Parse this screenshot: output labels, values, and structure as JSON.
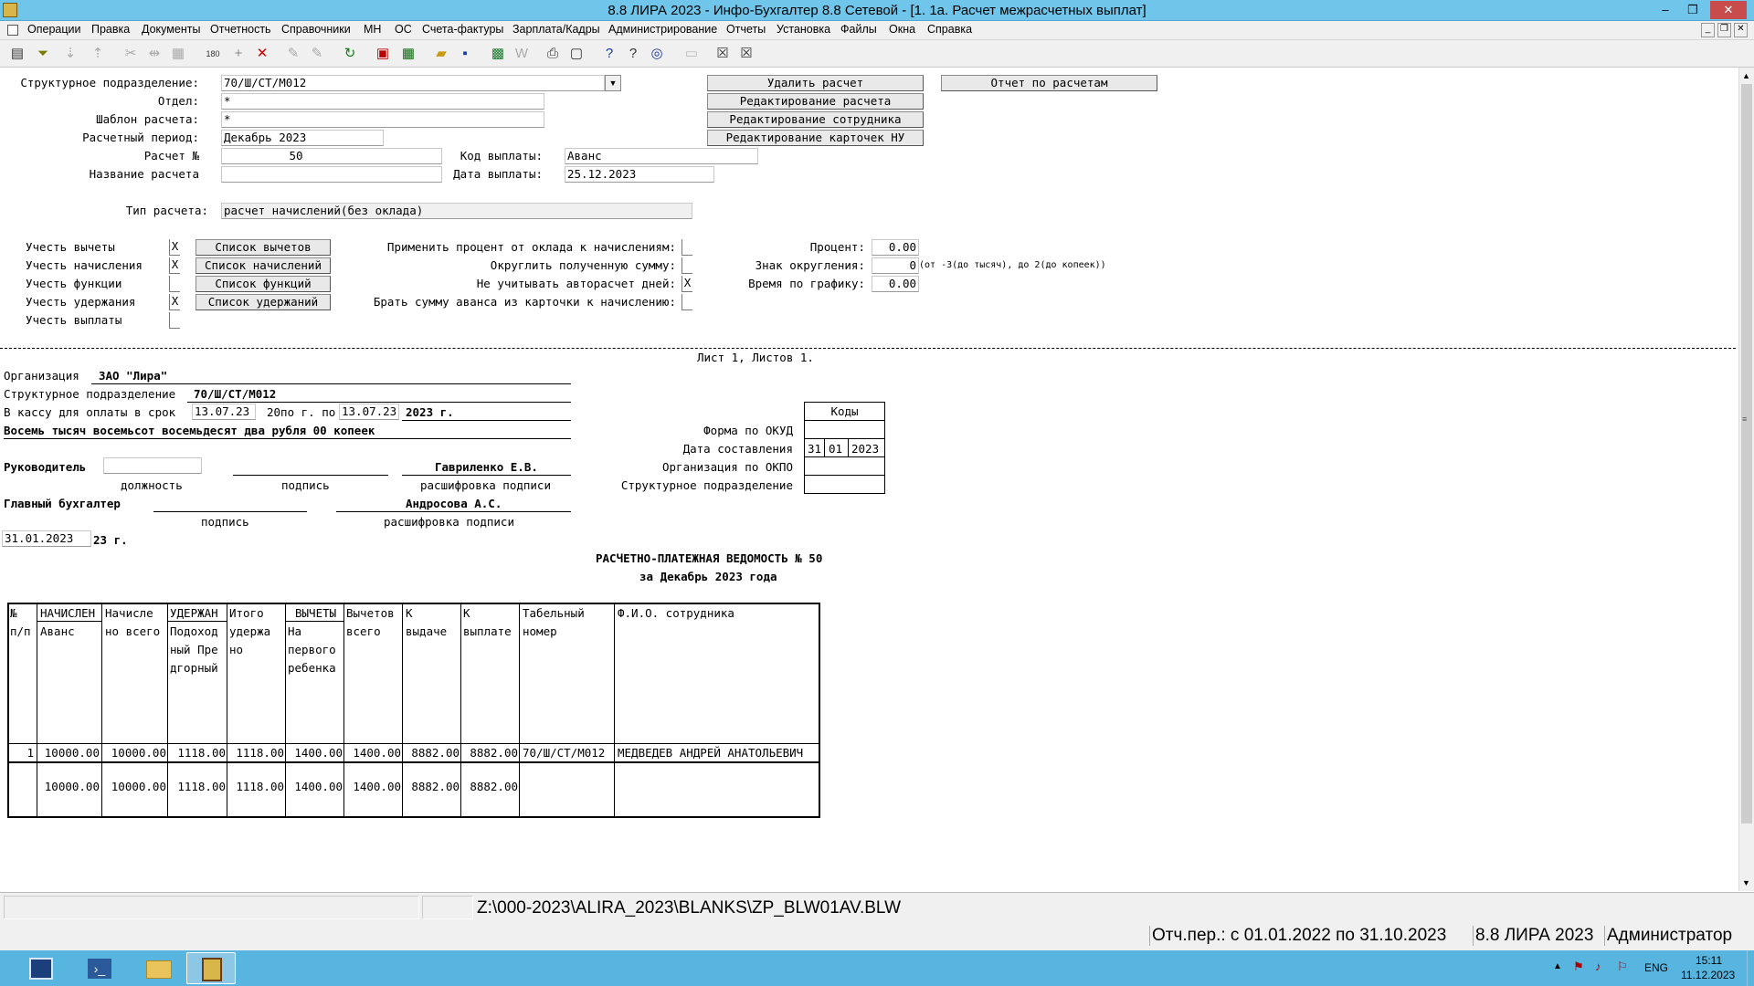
{
  "window": {
    "title": "8.8 ЛИРА 2023 - Инфо-Бухгалтер 8.8 Сетевой - [1. 1а. Расчет межрасчетных выплат]",
    "minimize": "–",
    "restore": "❐",
    "close": "✕"
  },
  "menu": [
    "Операции",
    "Правка",
    "Документы",
    "Отчетность",
    "Справочники",
    "МН",
    "ОС",
    "Счета-фактуры",
    "Зарплата/Кадры",
    "Администрирование",
    "Отчеты",
    "Установка",
    "Файлы",
    "Окна",
    "Справка"
  ],
  "form": {
    "struct_label": "Структурное подразделение:",
    "struct_value": "70/Ш/СТ/М012",
    "dept_label": "Отдел:",
    "dept_value": "*",
    "template_label": "Шаблон расчета:",
    "template_value": "*",
    "period_label": "Расчетный период:",
    "period_value": "Декабрь 2023",
    "calc_no_label": "Расчет №",
    "calc_no_value": "50",
    "calc_name_label": "Название расчета",
    "calc_name_value": "",
    "pay_code_label": "Код выплаты:",
    "pay_code_value": "Аванс",
    "pay_date_label": "Дата выплаты:",
    "pay_date_value": "25.12.2023",
    "calc_type_label": "Тип расчета:",
    "calc_type_value": "расчет начислений(без оклада)",
    "btn_delete": "Удалить расчет",
    "btn_report": "Отчет по расчетам",
    "btn_edit_calc": "Редактирование расчета",
    "btn_edit_emp": "Редактирование сотрудника",
    "btn_edit_cards": "Редактирование карточек НУ",
    "chk_deductions": "Учесть вычеты",
    "chk_deductions_val": "X",
    "chk_accruals": "Учесть начисления",
    "chk_accruals_val": "X",
    "chk_functions": "Учесть функции",
    "chk_functions_val": "",
    "chk_withholdings": "Учесть удержания",
    "chk_withholdings_val": "X",
    "chk_payments": "Учесть выплаты",
    "chk_payments_val": "",
    "btn_list_deductions": "Список вычетов",
    "btn_list_accruals": "Список начислений",
    "btn_list_functions": "Список функций",
    "btn_list_withholdings": "Список удержаний",
    "opt_percent": "Применить процент от оклада к начислениям:",
    "opt_percent_val": "",
    "opt_round": "Округлить полученную сумму:",
    "opt_round_val": "",
    "opt_autodays": "Не учитывать авторасчет дней:",
    "opt_autodays_val": "X",
    "opt_advance": "Брать сумму аванса из карточки к начислению:",
    "opt_advance_val": "",
    "percent_label": "Процент:",
    "percent_value": "0.00",
    "round_sign_label": "Знак округления:",
    "round_sign_value": "0",
    "round_sign_hint": "(от -3(до тысяч), до 2(до копеек))",
    "schedule_label": "Время по графику:",
    "schedule_value": "0.00"
  },
  "report": {
    "sheet": "Лист 1, Листов 1.",
    "org_label": "Организация",
    "org_value": "ЗАО \"Лира\"",
    "struct_label": "Структурное подразделение",
    "struct_value": "70/Ш/СТ/М012",
    "cash_label": "В кассу для оплаты в срок",
    "cash_from": "13.07.23",
    "cash_mid": "20по г. по",
    "cash_to": "13.07.23",
    "cash_year": "2023 г.",
    "sum_words": "Восемь тысяч восемьсот восемьдесят два рубля 00 копеек",
    "codes_header": "Коды",
    "okud_label": "Форма по ОКУД",
    "date_label": "Дата составления",
    "date_d": "31",
    "date_m": "01",
    "date_y": "2023",
    "okpo_label": "Организация по ОКПО",
    "struct_code_label": "Структурное подразделение",
    "head_label": "Руководитель",
    "head_name": "Гавриленко Е.В.",
    "position_caption": "должность",
    "sign_caption": "подпись",
    "decode_caption": "расшифровка подписи",
    "chief_label": "Главный бухгалтер",
    "chief_name": "Андросова А.С.",
    "sign_caption2": "подпись",
    "decode_caption2": "расшифровка подписи",
    "sign_date": "31.01.2023",
    "sign_date_suffix": "23 г.",
    "doc_title": "РАСЧЕТНО-ПЛАТЕЖНАЯ ВЕДОМОСТЬ № 50",
    "doc_subtitle": "за Декабрь 2023 года",
    "table": {
      "h_no": [
        "№",
        "п/п"
      ],
      "h_acc": [
        "НАЧИСЛЕН",
        "Аванс"
      ],
      "h_acc_total": [
        "Начисле",
        "но всего"
      ],
      "h_wh": [
        "УДЕРЖАН",
        "Подоход",
        "ный Пре",
        "дгорный"
      ],
      "h_wh_total": [
        "Итого",
        "удержа",
        "но"
      ],
      "h_ded": [
        "ВЫЧЕТЫ",
        "На",
        "первого",
        "ребенка"
      ],
      "h_ded_total": [
        "Вычетов",
        "всего"
      ],
      "h_issue": [
        "К",
        "выдаче"
      ],
      "h_pay": [
        "К",
        "выплате"
      ],
      "h_tab": [
        "Табельный",
        "номер"
      ],
      "h_fio": [
        "Ф.И.О. сотрудника"
      ],
      "row": [
        "1",
        "10000.00",
        "10000.00",
        "1118.00",
        "1118.00",
        "1400.00",
        "1400.00",
        "8882.00",
        "8882.00",
        "70/Ш/СТ/М012",
        "МЕДВЕДЕВ АНДРЕЙ АНАТОЛЬЕВИЧ"
      ],
      "total": [
        "",
        "10000.00",
        "10000.00",
        "1118.00",
        "1118.00",
        "1400.00",
        "1400.00",
        "8882.00",
        "8882.00",
        "",
        ""
      ]
    }
  },
  "status": {
    "path": "Z:\\000-2023\\ALIRA_2023\\BLANKS\\ZP_BLW01AV.BLW",
    "period": "Отч.пер.: с 01.01.2022 по 31.10.2023",
    "version": "8.8 ЛИРА 2023",
    "user": "Администратор"
  },
  "taskbar": {
    "lang": "ENG",
    "time": "15:11",
    "date": "11.12.2023"
  },
  "colors": {
    "titlebar": "#6fc6ea",
    "taskbar": "#57b5df"
  }
}
